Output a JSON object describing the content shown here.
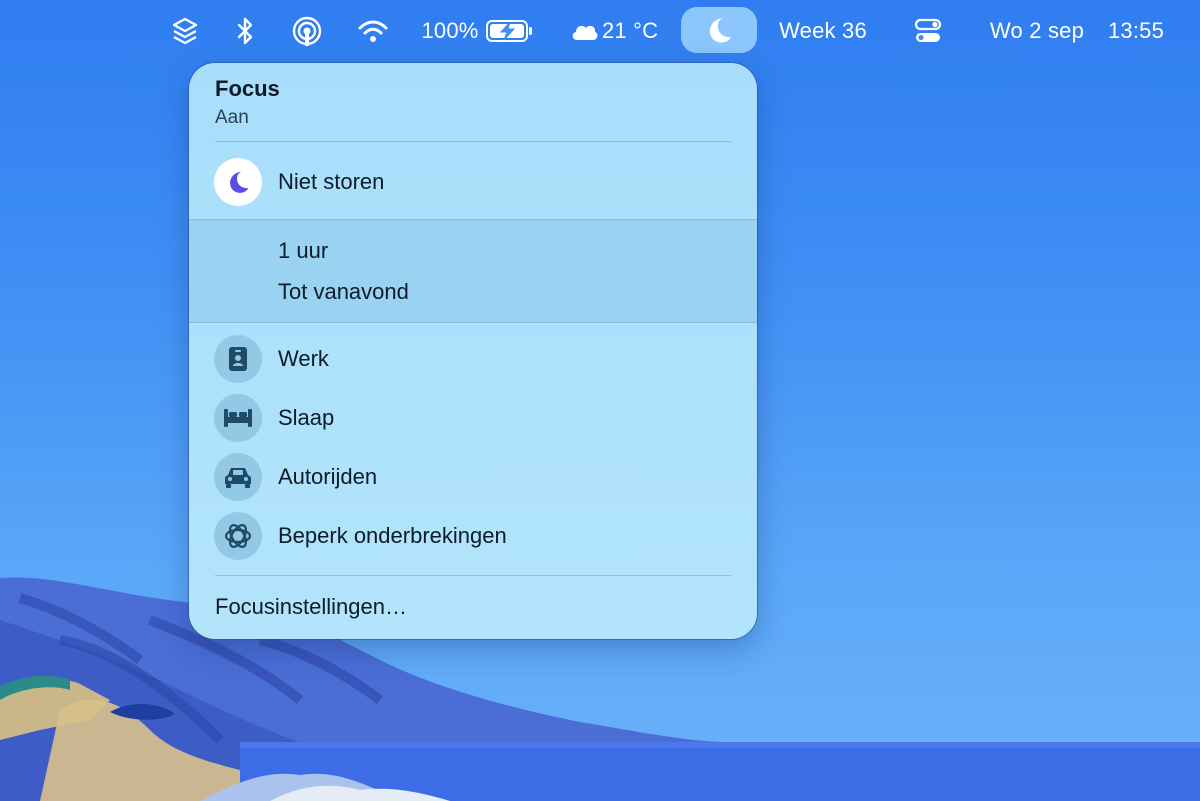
{
  "menubar": {
    "battery_percent": "100%",
    "weather": {
      "temp": "21 °C",
      "icon": "cloud-icon"
    },
    "week": "Week 36",
    "date": "Wo 2 sep",
    "time": "13:55",
    "icons": [
      "layers-icon",
      "bluetooth-icon",
      "airdrop-icon",
      "wifi-icon",
      "battery-charging-icon",
      "cloud-icon",
      "moon-icon",
      "control-center-icon"
    ]
  },
  "focus_menu": {
    "title": "Focus",
    "status": "Aan",
    "do_not_disturb": {
      "label": "Niet storen",
      "icon": "moon-icon",
      "accent": "#5b4fe0"
    },
    "durations": [
      "1 uur",
      "Tot vanavond"
    ],
    "modes": [
      {
        "label": "Werk",
        "icon": "id-badge-icon"
      },
      {
        "label": "Slaap",
        "icon": "bed-icon"
      },
      {
        "label": "Autorijden",
        "icon": "car-icon"
      },
      {
        "label": "Beperk onderbrekingen",
        "icon": "reduce-interruptions-icon"
      }
    ],
    "settings_label": "Focusinstellingen…"
  },
  "colors": {
    "menu_background": "#b0e3fb",
    "icon_tint": "#1f4b66",
    "desktop_sky": "#3f8ff5"
  }
}
